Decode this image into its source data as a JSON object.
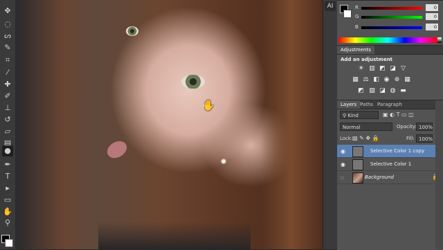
{
  "mini_strip": {
    "label": "AI"
  },
  "color_panel": {
    "channels": [
      {
        "label": "R",
        "value": "0"
      },
      {
        "label": "G",
        "value": "0"
      },
      {
        "label": "B",
        "value": "0"
      }
    ]
  },
  "adjustments": {
    "tabs": [
      "Adjustments"
    ],
    "title": "Add an adjustment"
  },
  "layers_panel": {
    "tabs": [
      "Layers",
      "Paths",
      "Paragraph"
    ],
    "kind_label": "Kind",
    "blend_mode": "Normal",
    "opacity_label": "Opacity:",
    "opacity_value": "100%",
    "lock_label": "Lock:",
    "fill_label": "Fill:",
    "fill_value": "100%",
    "layers": [
      {
        "name": "Selective Color 1 copy"
      },
      {
        "name": "Selective Color 1"
      },
      {
        "name": "Background"
      }
    ]
  }
}
